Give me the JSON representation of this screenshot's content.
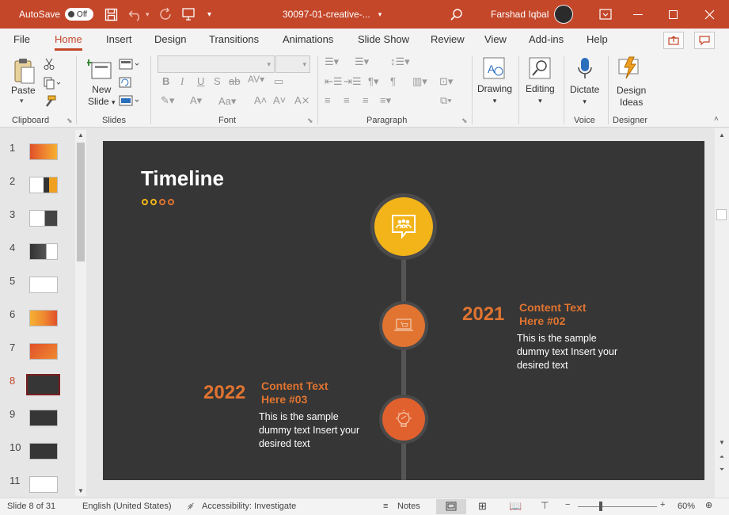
{
  "titlebar": {
    "autosave_label": "AutoSave",
    "autosave_state": "Off",
    "filename": "30097-01-creative-...",
    "user": "Farshad Iqbal"
  },
  "tabs": [
    "File",
    "Home",
    "Insert",
    "Design",
    "Transitions",
    "Animations",
    "Slide Show",
    "Review",
    "View",
    "Add-ins",
    "Help"
  ],
  "ribbon": {
    "clipboard": {
      "paste": "Paste",
      "label": "Clipboard"
    },
    "slides": {
      "new_slide_line1": "New",
      "new_slide_line2": "Slide",
      "label": "Slides"
    },
    "font": {
      "label": "Font"
    },
    "paragraph": {
      "label": "Paragraph"
    },
    "drawing": {
      "label": "Drawing"
    },
    "editing": {
      "label": "Editing"
    },
    "voice": {
      "dictate": "Dictate",
      "label": "Voice"
    },
    "designer": {
      "ideas_line1": "Design",
      "ideas_line2": "Ideas",
      "label": "Designer"
    }
  },
  "thumbnails": [
    "1",
    "2",
    "3",
    "4",
    "5",
    "6",
    "7",
    "8",
    "9",
    "10",
    "11"
  ],
  "selected_slide": "8",
  "slide": {
    "title": "Timeline",
    "items": [
      {
        "year": "2021",
        "title_line1": "Content Text",
        "title_line2": "Here #02",
        "body_line1": "This is the sample",
        "body_line2": "dummy text Insert your",
        "body_line3": "desired text"
      },
      {
        "year": "2022",
        "title_line1": "Content Text",
        "title_line2": "Here #03",
        "body_line1": "This is the sample",
        "body_line2": "dummy text Insert your",
        "body_line3": "desired text"
      }
    ]
  },
  "statusbar": {
    "slide_info": "Slide 8 of 31",
    "language": "English (United States)",
    "accessibility": "Accessibility: Investigate",
    "notes": "Notes",
    "zoom": "60%"
  },
  "colors": {
    "accent": "#c4472a",
    "slide_bg": "#363636",
    "orange": "#e07430",
    "yellow": "#f3b41a"
  }
}
